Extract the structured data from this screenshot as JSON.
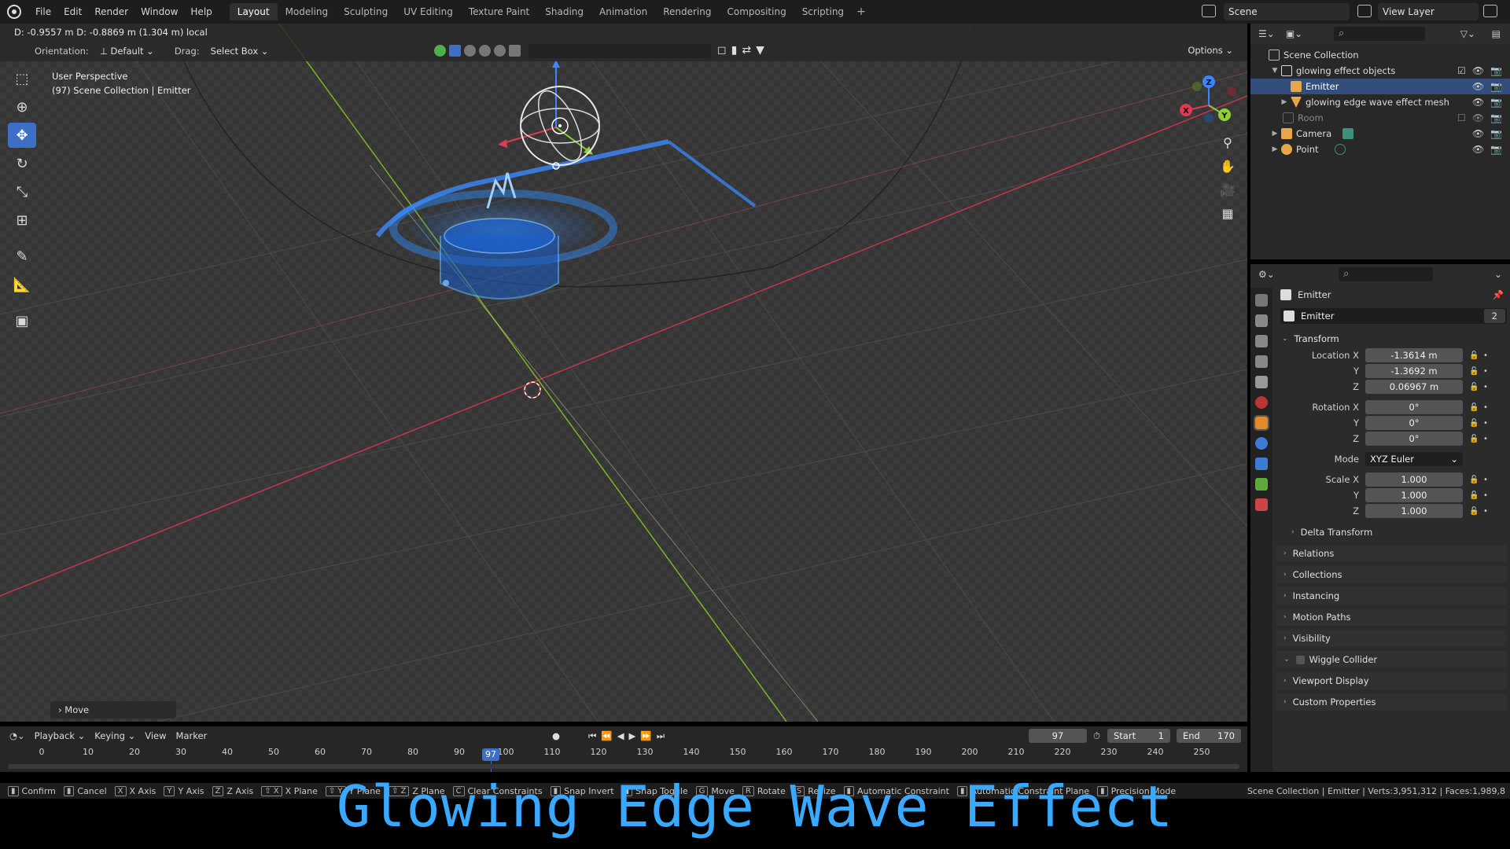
{
  "menubar": {
    "items": [
      "File",
      "Edit",
      "Render",
      "Window",
      "Help"
    ],
    "workspaces": [
      "Layout",
      "Modeling",
      "Sculpting",
      "UV Editing",
      "Texture Paint",
      "Shading",
      "Animation",
      "Rendering",
      "Compositing",
      "Scripting"
    ],
    "active_workspace": "Layout",
    "add_tab": "+",
    "scene": "Scene",
    "view_layer": "View Layer"
  },
  "viewport": {
    "status": "D: -0.9557 m   D: -0.8869 m (1.304 m) local",
    "orientation_label": "Orientation:",
    "orientation_value": "Default",
    "drag_label": "Drag:",
    "drag_value": "Select Box",
    "options": "Options",
    "perspective": "User Perspective",
    "collection_info": "(97) Scene Collection | Emitter",
    "operator_panel": "Move",
    "search_icon": "⌕"
  },
  "outliner": {
    "rows": [
      {
        "label": "Scene Collection",
        "level": 0
      },
      {
        "label": "glowing effect objects",
        "level": 1
      },
      {
        "label": "Emitter",
        "level": 2,
        "selected": true
      },
      {
        "label": "glowing edge wave effect mesh",
        "level": 2
      },
      {
        "label": "Room",
        "level": 1,
        "dim": true
      },
      {
        "label": "Camera",
        "level": 1
      },
      {
        "label": "Point",
        "level": 1
      }
    ]
  },
  "properties": {
    "object_name": "Emitter",
    "datablock_name": "Emitter",
    "datablock_users": "2",
    "transform_title": "Transform",
    "location": {
      "label": "Location X",
      "x": "-1.3614 m",
      "y": "-1.3692 m",
      "z": "0.06967 m"
    },
    "rotation": {
      "label": "Rotation X",
      "x": "0°",
      "y": "0°",
      "z": "0°"
    },
    "mode_label": "Mode",
    "mode_value": "XYZ Euler",
    "scale": {
      "label": "Scale X",
      "x": "1.000",
      "y": "1.000",
      "z": "1.000"
    },
    "axis_y": "Y",
    "axis_z": "Z",
    "delta_transform": "Delta Transform",
    "panels": [
      "Relations",
      "Collections",
      "Instancing",
      "Motion Paths",
      "Visibility",
      "Wiggle Collider",
      "Viewport Display",
      "Custom Properties"
    ]
  },
  "timeline": {
    "menus": [
      "Playback",
      "Keying",
      "View",
      "Marker"
    ],
    "current_frame": "97",
    "start_label": "Start",
    "start_value": "1",
    "end_label": "End",
    "end_value": "170",
    "ticks": [
      "0",
      "10",
      "20",
      "30",
      "40",
      "50",
      "60",
      "70",
      "80",
      "90",
      "100",
      "110",
      "120",
      "130",
      "140",
      "150",
      "160",
      "170",
      "180",
      "190",
      "200",
      "210",
      "220",
      "230",
      "240",
      "250"
    ]
  },
  "statusbar": {
    "items": [
      {
        "key": "",
        "label": "Confirm"
      },
      {
        "key": "",
        "label": "Cancel"
      },
      {
        "key": "X",
        "label": "X Axis"
      },
      {
        "key": "Y",
        "label": "Y Axis"
      },
      {
        "key": "Z",
        "label": "Z Axis"
      },
      {
        "key": "⇧ X",
        "label": "X Plane"
      },
      {
        "key": "⇧ Y",
        "label": "Y Plane"
      },
      {
        "key": "⇧ Z",
        "label": "Z Plane"
      },
      {
        "key": "C",
        "label": "Clear Constraints"
      },
      {
        "key": "",
        "label": "Snap Invert"
      },
      {
        "key": "",
        "label": "Snap Toggle"
      },
      {
        "key": "G",
        "label": "Move"
      },
      {
        "key": "R",
        "label": "Rotate"
      },
      {
        "key": "S",
        "label": "Resize"
      },
      {
        "key": "",
        "label": "Automatic Constraint"
      },
      {
        "key": "",
        "label": "Automatic Constraint Plane"
      },
      {
        "key": "",
        "label": "Precision Mode"
      }
    ],
    "scene_stats": "Scene Collection | Emitter | Verts:3,951,312 | Faces:1,989,8"
  },
  "caption": "Glowing Edge Wave Effect",
  "colors": {
    "accent": "#3d6fc7",
    "x_axis": "#c7344a",
    "y_axis": "#7db324",
    "glow": "#2f8dff",
    "caption": "#39a8ff"
  }
}
